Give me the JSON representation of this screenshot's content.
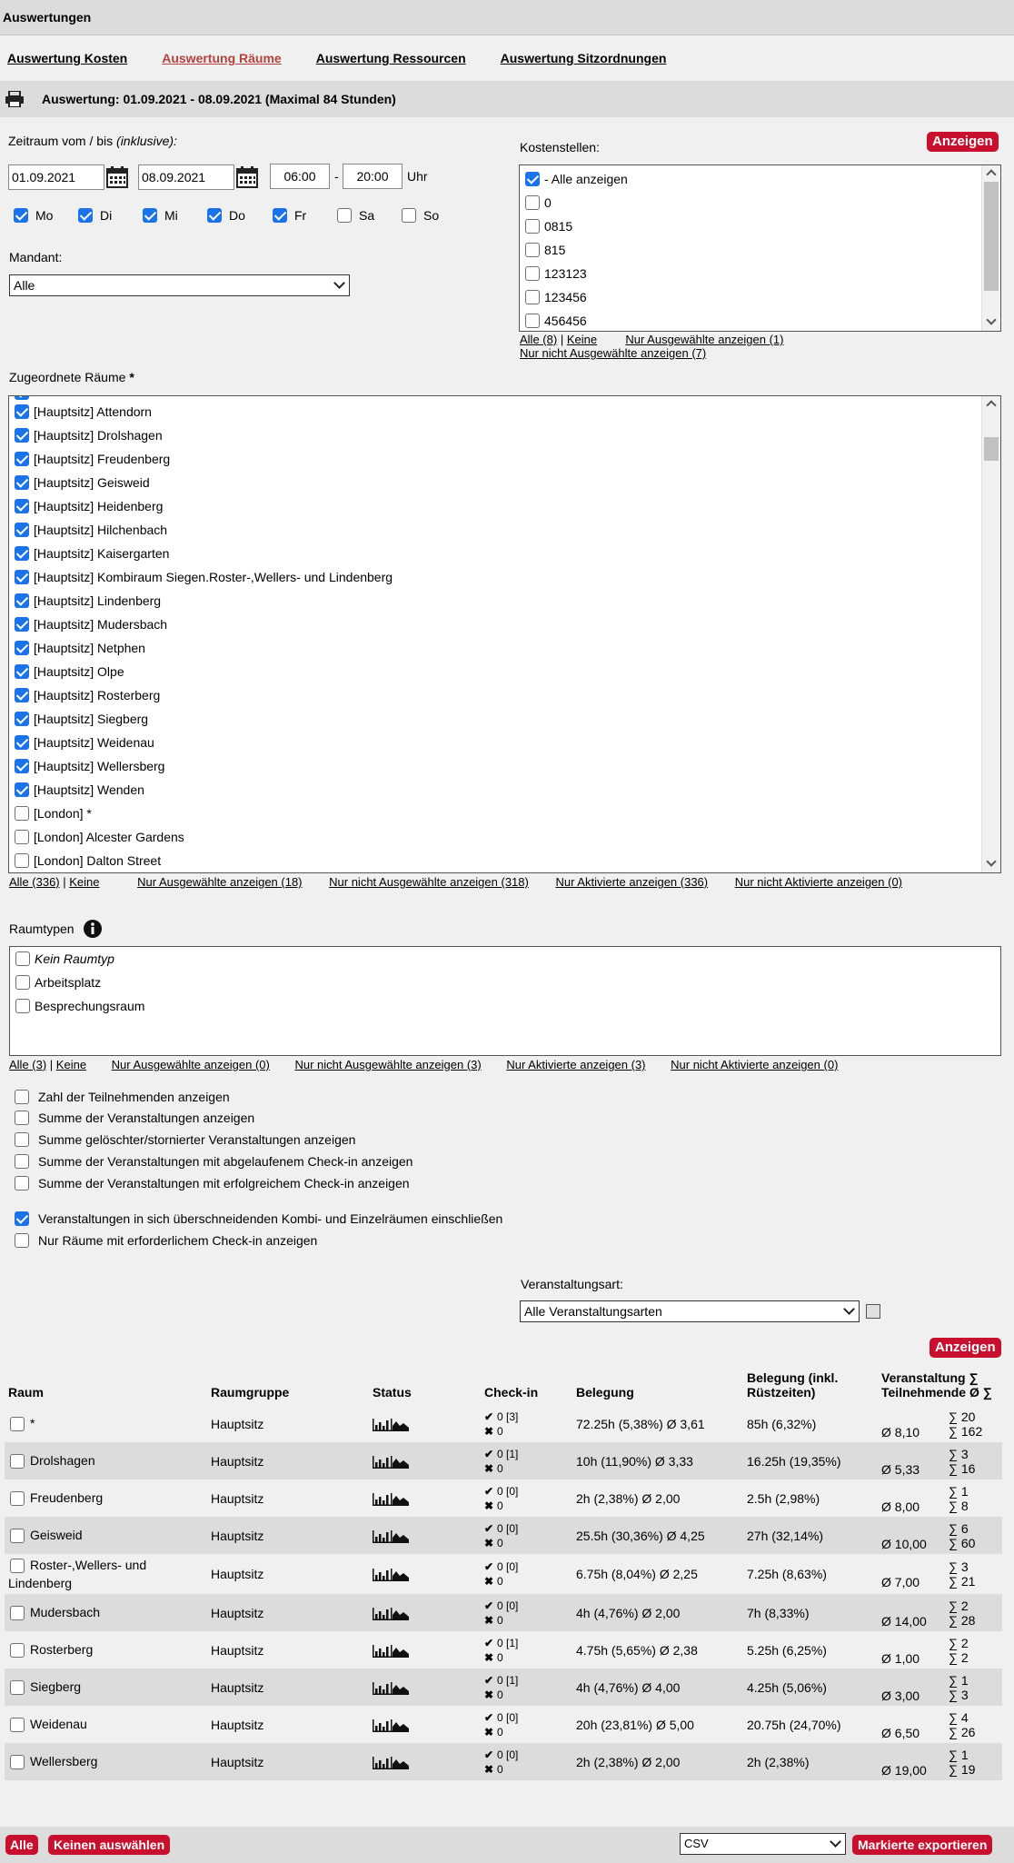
{
  "header": {
    "title": "Auswertungen"
  },
  "tabs": [
    {
      "label": "Auswertung Kosten"
    },
    {
      "label": "Auswertung Räume"
    },
    {
      "label": "Auswertung Ressourcen"
    },
    {
      "label": "Auswertung Sitzordnungen"
    }
  ],
  "range": {
    "text": "Auswertung: 01.09.2021 - 08.09.2021 (Maximal 84 Stunden)"
  },
  "period": {
    "label": "Zeitraum vom / bis",
    "label_note": "(inklusive):",
    "from_date": "01.09.2021",
    "to_date": "08.09.2021",
    "from_time": "06:00",
    "dash": "-",
    "to_time": "20:00",
    "unit": "Uhr"
  },
  "weekdays": [
    {
      "label": "Mo",
      "checked": true
    },
    {
      "label": "Di",
      "checked": true
    },
    {
      "label": "Mi",
      "checked": true
    },
    {
      "label": "Do",
      "checked": true
    },
    {
      "label": "Fr",
      "checked": true
    },
    {
      "label": "Sa",
      "checked": false
    },
    {
      "label": "So",
      "checked": false
    }
  ],
  "mandant": {
    "label": "Mandant:",
    "value": "Alle"
  },
  "cost": {
    "label": "Kostenstellen:",
    "show_button": "Anzeigen",
    "items": [
      {
        "label": "- Alle anzeigen",
        "checked": true
      },
      {
        "label": "0",
        "checked": false
      },
      {
        "label": "0815",
        "checked": false
      },
      {
        "label": "815",
        "checked": false
      },
      {
        "label": "123123",
        "checked": false
      },
      {
        "label": "123456",
        "checked": false
      },
      {
        "label": "456456",
        "checked": false
      }
    ],
    "link_all": "Alle (8)",
    "sep": "|",
    "link_none": "Keine",
    "link_selected": "Nur Ausgewählte anzeigen (1)",
    "link_unselected": "Nur nicht Ausgewählte anzeigen (7)"
  },
  "rooms": {
    "label": "Zugeordnete Räume",
    "required_mark": "*",
    "items": [
      {
        "label": "[Hauptsitz] Attendorn",
        "checked": true
      },
      {
        "label": "[Hauptsitz] Drolshagen",
        "checked": true
      },
      {
        "label": "[Hauptsitz] Freudenberg",
        "checked": true
      },
      {
        "label": "[Hauptsitz] Geisweid",
        "checked": true
      },
      {
        "label": "[Hauptsitz] Heidenberg",
        "checked": true
      },
      {
        "label": "[Hauptsitz] Hilchenbach",
        "checked": true
      },
      {
        "label": "[Hauptsitz] Kaisergarten",
        "checked": true
      },
      {
        "label": "[Hauptsitz] Kombiraum Siegen.Roster-,Wellers- und Lindenberg",
        "checked": true
      },
      {
        "label": "[Hauptsitz] Lindenberg",
        "checked": true
      },
      {
        "label": "[Hauptsitz] Mudersbach",
        "checked": true
      },
      {
        "label": "[Hauptsitz] Netphen",
        "checked": true
      },
      {
        "label": "[Hauptsitz] Olpe",
        "checked": true
      },
      {
        "label": "[Hauptsitz] Rosterberg",
        "checked": true
      },
      {
        "label": "[Hauptsitz] Siegberg",
        "checked": true
      },
      {
        "label": "[Hauptsitz] Weidenau",
        "checked": true
      },
      {
        "label": "[Hauptsitz] Wellersberg",
        "checked": true
      },
      {
        "label": "[Hauptsitz] Wenden",
        "checked": true
      },
      {
        "label": "[London] *",
        "checked": false
      },
      {
        "label": "[London] Alcester Gardens",
        "checked": false
      },
      {
        "label": "[London] Dalton Street",
        "checked": false
      }
    ],
    "links": [
      "Alle (336)",
      "Keine",
      "Nur Ausgewählte anzeigen (18)",
      "Nur nicht Ausgewählte anzeigen (318)",
      "Nur Aktivierte anzeigen (336)",
      "Nur nicht Aktivierte anzeigen (0)"
    ]
  },
  "roomtypes": {
    "label": "Raumtypen",
    "items": [
      {
        "label": "Kein Raumtyp",
        "checked": false,
        "italic": true
      },
      {
        "label": "Arbeitsplatz",
        "checked": false
      },
      {
        "label": "Besprechungsraum",
        "checked": false
      }
    ],
    "links": [
      "Alle (3)",
      "Keine",
      "Nur Ausgewählte anzeigen (0)",
      "Nur nicht Ausgewählte anzeigen (3)",
      "Nur Aktivierte anzeigen (3)",
      "Nur nicht Aktivierte anzeigen (0)"
    ]
  },
  "options": [
    {
      "label": "Zahl der Teilnehmenden anzeigen",
      "checked": false
    },
    {
      "label": "Summe der Veranstaltungen anzeigen",
      "checked": false
    },
    {
      "label": "Summe gelöschter/stornierter Veranstaltungen anzeigen",
      "checked": false
    },
    {
      "label": "Summe der Veranstaltungen mit abgelaufenem Check-in anzeigen",
      "checked": false
    },
    {
      "label": "Summe der Veranstaltungen mit erfolgreichem Check-in anzeigen",
      "checked": false
    },
    {
      "label": "Veranstaltungen in sich überschneidenden Kombi- und Einzelräumen einschließen",
      "checked": true
    },
    {
      "label": "Nur Räume mit erforderlichem Check-in anzeigen",
      "checked": false
    }
  ],
  "event_type": {
    "label": "Veranstaltungsart:",
    "value": "Alle Veranstaltungsarten",
    "show_button": "Anzeigen"
  },
  "table": {
    "headers": {
      "room": "Raum",
      "group": "Raumgruppe",
      "status": "Status",
      "checkin": "Check-in",
      "occupancy": "Belegung",
      "occupancy_incl": "Belegung (inkl. Rüstzeiten)",
      "events": "Veranstaltung ∑ Teilnehmende Ø ∑"
    },
    "rows": [
      {
        "room": "*",
        "group": "Hauptsitz",
        "ok": "0 [3]",
        "fail": "0",
        "occ": "72.25h (5,38%) Ø 3,61",
        "occ_incl": "85h (6,32%)",
        "avg": "Ø 8,10",
        "sum1": "∑ 20",
        "sum2": "∑ 162"
      },
      {
        "room": "Drolshagen",
        "group": "Hauptsitz",
        "ok": "0 [1]",
        "fail": "0",
        "occ": "10h (11,90%) Ø 3,33",
        "occ_incl": "16.25h (19,35%)",
        "avg": "Ø 5,33",
        "sum1": "∑ 3",
        "sum2": "∑ 16"
      },
      {
        "room": "Freudenberg",
        "group": "Hauptsitz",
        "ok": "0 [0]",
        "fail": "0",
        "occ": "2h (2,38%) Ø 2,00",
        "occ_incl": "2.5h (2,98%)",
        "avg": "Ø 8,00",
        "sum1": "∑ 1",
        "sum2": "∑ 8"
      },
      {
        "room": "Geisweid",
        "group": "Hauptsitz",
        "ok": "0 [0]",
        "fail": "0",
        "occ": "25.5h (30,36%) Ø 4,25",
        "occ_incl": "27h (32,14%)",
        "avg": "Ø 10,00",
        "sum1": "∑ 6",
        "sum2": "∑ 60"
      },
      {
        "room": "Roster-,Wellers- und Lindenberg",
        "group": "Hauptsitz",
        "ok": "0 [0]",
        "fail": "0",
        "occ": "6.75h (8,04%) Ø 2,25",
        "occ_incl": "7.25h (8,63%)",
        "avg": "Ø 7,00",
        "sum1": "∑ 3",
        "sum2": "∑ 21"
      },
      {
        "room": "Mudersbach",
        "group": "Hauptsitz",
        "ok": "0 [0]",
        "fail": "0",
        "occ": "4h (4,76%) Ø 2,00",
        "occ_incl": "7h (8,33%)",
        "avg": "Ø 14,00",
        "sum1": "∑ 2",
        "sum2": "∑ 28"
      },
      {
        "room": "Rosterberg",
        "group": "Hauptsitz",
        "ok": "0 [1]",
        "fail": "0",
        "occ": "4.75h (5,65%) Ø 2,38",
        "occ_incl": "5.25h (6,25%)",
        "avg": "Ø 1,00",
        "sum1": "∑ 2",
        "sum2": "∑ 2"
      },
      {
        "room": "Siegberg",
        "group": "Hauptsitz",
        "ok": "0 [1]",
        "fail": "0",
        "occ": "4h (4,76%) Ø 4,00",
        "occ_incl": "4.25h (5,06%)",
        "avg": "Ø 3,00",
        "sum1": "∑ 1",
        "sum2": "∑ 3"
      },
      {
        "room": "Weidenau",
        "group": "Hauptsitz",
        "ok": "0 [0]",
        "fail": "0",
        "occ": "20h (23,81%) Ø 5,00",
        "occ_incl": "20.75h (24,70%)",
        "avg": "Ø 6,50",
        "sum1": "∑ 4",
        "sum2": "∑ 26"
      },
      {
        "room": "Wellersberg",
        "group": "Hauptsitz",
        "ok": "0 [0]",
        "fail": "0",
        "occ": "2h (2,38%) Ø 2,00",
        "occ_incl": "2h (2,38%)",
        "avg": "Ø 19,00",
        "sum1": "∑ 1",
        "sum2": "∑ 19"
      }
    ]
  },
  "footer": {
    "all_button": "Alle",
    "none_button": "Keinen auswählen",
    "format": "CSV",
    "export_button": "Markierte exportieren"
  },
  "colors": {
    "accent_red": "#c8102e",
    "checkbox_blue": "#1a73e8",
    "tab_active": "#b4413d"
  }
}
